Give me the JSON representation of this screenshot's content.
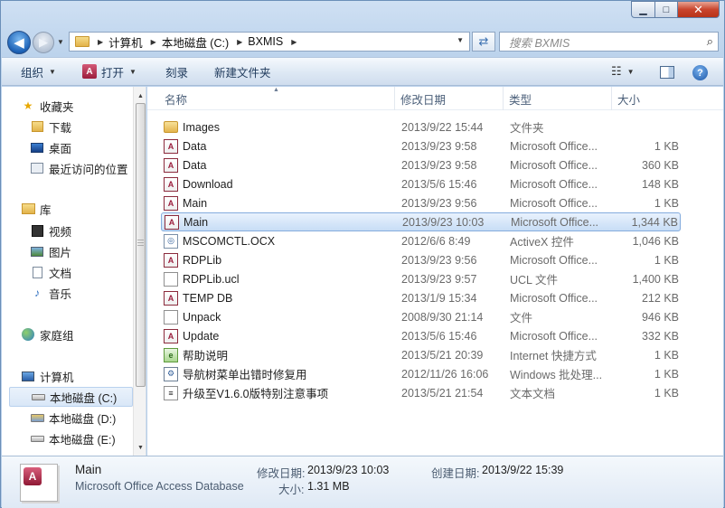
{
  "window": {
    "minimize": "▭",
    "maximize": "□",
    "close": "✕"
  },
  "address": {
    "crumbs": [
      "计算机",
      "本地磁盘 (C:)",
      "BXMIS"
    ],
    "search_placeholder": "搜索 BXMIS"
  },
  "toolbar": {
    "organize": "组织",
    "open": "打开",
    "burn": "刻录",
    "new_folder": "新建文件夹"
  },
  "nav": {
    "favorites": "收藏夹",
    "downloads": "下载",
    "desktop": "桌面",
    "recent": "最近访问的位置",
    "libraries": "库",
    "videos": "视频",
    "pictures": "图片",
    "documents": "文档",
    "music": "音乐",
    "homegroup": "家庭组",
    "computer": "计算机",
    "drive_c": "本地磁盘 (C:)",
    "drive_d": "本地磁盘 (D:)",
    "drive_e": "本地磁盘 (E:)"
  },
  "columns": {
    "name": "名称",
    "date": "修改日期",
    "type": "类型",
    "size": "大小"
  },
  "files": [
    {
      "name": "Images",
      "date": "2013/9/22 15:44",
      "type": "文件夹",
      "size": "",
      "icon": "folder-icon"
    },
    {
      "name": "Data",
      "date": "2013/9/23 9:58",
      "type": "Microsoft Office...",
      "size": "1 KB",
      "icon": "access-shortcut-icon"
    },
    {
      "name": "Data",
      "date": "2013/9/23 9:58",
      "type": "Microsoft Office...",
      "size": "360 KB",
      "icon": "access-database-icon"
    },
    {
      "name": "Download",
      "date": "2013/5/6 15:46",
      "type": "Microsoft Office...",
      "size": "148 KB",
      "icon": "access-database-icon"
    },
    {
      "name": "Main",
      "date": "2013/9/23 9:56",
      "type": "Microsoft Office...",
      "size": "1 KB",
      "icon": "access-shortcut-icon"
    },
    {
      "name": "Main",
      "date": "2013/9/23 10:03",
      "type": "Microsoft Office...",
      "size": "1,344 KB",
      "icon": "access-database-icon"
    },
    {
      "name": "MSCOMCTL.OCX",
      "date": "2012/6/6 8:49",
      "type": "ActiveX 控件",
      "size": "1,046 KB",
      "icon": "activex-icon"
    },
    {
      "name": "RDPLib",
      "date": "2013/9/23 9:56",
      "type": "Microsoft Office...",
      "size": "1 KB",
      "icon": "access-shortcut-icon"
    },
    {
      "name": "RDPLib.ucl",
      "date": "2013/9/23 9:57",
      "type": "UCL 文件",
      "size": "1,400 KB",
      "icon": "blank-file-icon"
    },
    {
      "name": "TEMP DB",
      "date": "2013/1/9 15:34",
      "type": "Microsoft Office...",
      "size": "212 KB",
      "icon": "access-database-icon"
    },
    {
      "name": "Unpack",
      "date": "2008/9/30 21:14",
      "type": "文件",
      "size": "946 KB",
      "icon": "blank-file-icon"
    },
    {
      "name": "Update",
      "date": "2013/5/6 15:46",
      "type": "Microsoft Office...",
      "size": "332 KB",
      "icon": "access-database-icon"
    },
    {
      "name": "帮助说明",
      "date": "2013/5/21 20:39",
      "type": "Internet 快捷方式",
      "size": "1 KB",
      "icon": "internet-shortcut-icon"
    },
    {
      "name": "导航树菜单出错时修复用",
      "date": "2012/11/26 16:06",
      "type": "Windows 批处理...",
      "size": "1 KB",
      "icon": "batch-file-icon"
    },
    {
      "name": "升级至V1.6.0版特别注意事项",
      "date": "2013/5/21 21:54",
      "type": "文本文档",
      "size": "1 KB",
      "icon": "text-file-icon"
    }
  ],
  "selected_index": 5,
  "details": {
    "name": "Main",
    "type": "Microsoft Office Access Database",
    "modified_label": "修改日期:",
    "modified_value": "2013/9/23 10:03",
    "created_label": "创建日期:",
    "created_value": "2013/9/22 15:39",
    "size_label": "大小:",
    "size_value": "1.31 MB"
  }
}
